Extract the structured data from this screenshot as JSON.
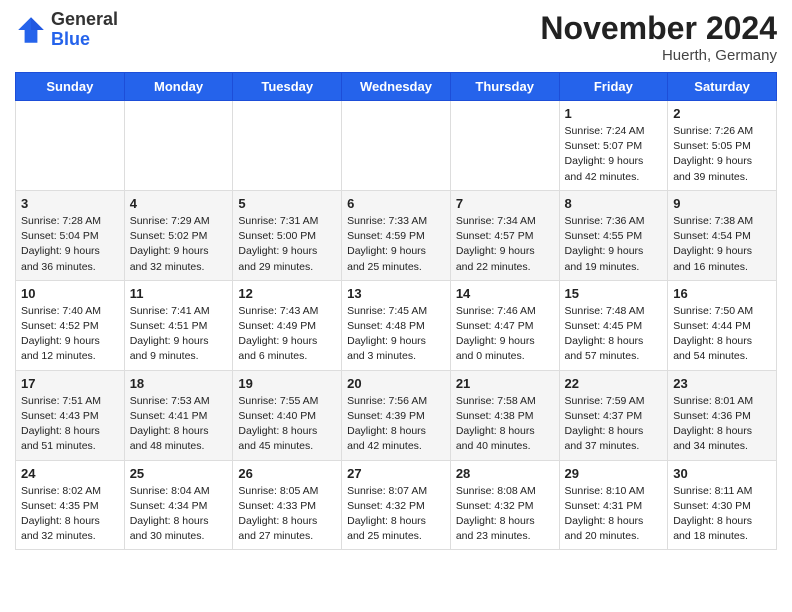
{
  "header": {
    "logo_general": "General",
    "logo_blue": "Blue",
    "month_title": "November 2024",
    "location": "Huerth, Germany"
  },
  "weekdays": [
    "Sunday",
    "Monday",
    "Tuesday",
    "Wednesday",
    "Thursday",
    "Friday",
    "Saturday"
  ],
  "weeks": [
    [
      {
        "day": "",
        "info": ""
      },
      {
        "day": "",
        "info": ""
      },
      {
        "day": "",
        "info": ""
      },
      {
        "day": "",
        "info": ""
      },
      {
        "day": "",
        "info": ""
      },
      {
        "day": "1",
        "info": "Sunrise: 7:24 AM\nSunset: 5:07 PM\nDaylight: 9 hours and 42 minutes."
      },
      {
        "day": "2",
        "info": "Sunrise: 7:26 AM\nSunset: 5:05 PM\nDaylight: 9 hours and 39 minutes."
      }
    ],
    [
      {
        "day": "3",
        "info": "Sunrise: 7:28 AM\nSunset: 5:04 PM\nDaylight: 9 hours and 36 minutes."
      },
      {
        "day": "4",
        "info": "Sunrise: 7:29 AM\nSunset: 5:02 PM\nDaylight: 9 hours and 32 minutes."
      },
      {
        "day": "5",
        "info": "Sunrise: 7:31 AM\nSunset: 5:00 PM\nDaylight: 9 hours and 29 minutes."
      },
      {
        "day": "6",
        "info": "Sunrise: 7:33 AM\nSunset: 4:59 PM\nDaylight: 9 hours and 25 minutes."
      },
      {
        "day": "7",
        "info": "Sunrise: 7:34 AM\nSunset: 4:57 PM\nDaylight: 9 hours and 22 minutes."
      },
      {
        "day": "8",
        "info": "Sunrise: 7:36 AM\nSunset: 4:55 PM\nDaylight: 9 hours and 19 minutes."
      },
      {
        "day": "9",
        "info": "Sunrise: 7:38 AM\nSunset: 4:54 PM\nDaylight: 9 hours and 16 minutes."
      }
    ],
    [
      {
        "day": "10",
        "info": "Sunrise: 7:40 AM\nSunset: 4:52 PM\nDaylight: 9 hours and 12 minutes."
      },
      {
        "day": "11",
        "info": "Sunrise: 7:41 AM\nSunset: 4:51 PM\nDaylight: 9 hours and 9 minutes."
      },
      {
        "day": "12",
        "info": "Sunrise: 7:43 AM\nSunset: 4:49 PM\nDaylight: 9 hours and 6 minutes."
      },
      {
        "day": "13",
        "info": "Sunrise: 7:45 AM\nSunset: 4:48 PM\nDaylight: 9 hours and 3 minutes."
      },
      {
        "day": "14",
        "info": "Sunrise: 7:46 AM\nSunset: 4:47 PM\nDaylight: 9 hours and 0 minutes."
      },
      {
        "day": "15",
        "info": "Sunrise: 7:48 AM\nSunset: 4:45 PM\nDaylight: 8 hours and 57 minutes."
      },
      {
        "day": "16",
        "info": "Sunrise: 7:50 AM\nSunset: 4:44 PM\nDaylight: 8 hours and 54 minutes."
      }
    ],
    [
      {
        "day": "17",
        "info": "Sunrise: 7:51 AM\nSunset: 4:43 PM\nDaylight: 8 hours and 51 minutes."
      },
      {
        "day": "18",
        "info": "Sunrise: 7:53 AM\nSunset: 4:41 PM\nDaylight: 8 hours and 48 minutes."
      },
      {
        "day": "19",
        "info": "Sunrise: 7:55 AM\nSunset: 4:40 PM\nDaylight: 8 hours and 45 minutes."
      },
      {
        "day": "20",
        "info": "Sunrise: 7:56 AM\nSunset: 4:39 PM\nDaylight: 8 hours and 42 minutes."
      },
      {
        "day": "21",
        "info": "Sunrise: 7:58 AM\nSunset: 4:38 PM\nDaylight: 8 hours and 40 minutes."
      },
      {
        "day": "22",
        "info": "Sunrise: 7:59 AM\nSunset: 4:37 PM\nDaylight: 8 hours and 37 minutes."
      },
      {
        "day": "23",
        "info": "Sunrise: 8:01 AM\nSunset: 4:36 PM\nDaylight: 8 hours and 34 minutes."
      }
    ],
    [
      {
        "day": "24",
        "info": "Sunrise: 8:02 AM\nSunset: 4:35 PM\nDaylight: 8 hours and 32 minutes."
      },
      {
        "day": "25",
        "info": "Sunrise: 8:04 AM\nSunset: 4:34 PM\nDaylight: 8 hours and 30 minutes."
      },
      {
        "day": "26",
        "info": "Sunrise: 8:05 AM\nSunset: 4:33 PM\nDaylight: 8 hours and 27 minutes."
      },
      {
        "day": "27",
        "info": "Sunrise: 8:07 AM\nSunset: 4:32 PM\nDaylight: 8 hours and 25 minutes."
      },
      {
        "day": "28",
        "info": "Sunrise: 8:08 AM\nSunset: 4:32 PM\nDaylight: 8 hours and 23 minutes."
      },
      {
        "day": "29",
        "info": "Sunrise: 8:10 AM\nSunset: 4:31 PM\nDaylight: 8 hours and 20 minutes."
      },
      {
        "day": "30",
        "info": "Sunrise: 8:11 AM\nSunset: 4:30 PM\nDaylight: 8 hours and 18 minutes."
      }
    ]
  ]
}
